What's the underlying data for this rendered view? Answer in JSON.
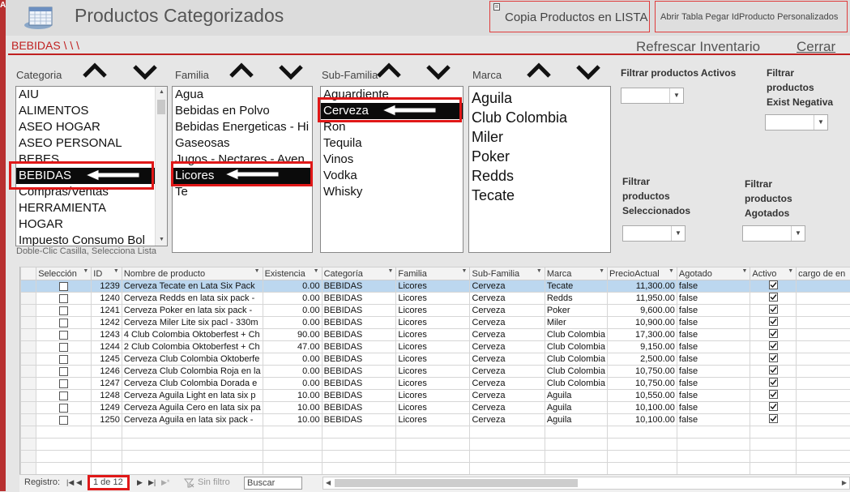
{
  "window": {
    "title": "Productos Categorizados",
    "left_strip_char": "A"
  },
  "toolbar": {
    "copy_label": "Copia Productos en LISTA",
    "open_label": "Abrir Tabla Pegar IdProducto Personalizados"
  },
  "header": {
    "breadcrumb": "BEBIDAS \\ \\ \\",
    "refresh_label": "Refrescar Inventario",
    "close_label": "Cerrar"
  },
  "categoria": {
    "label": "Categoria",
    "items": [
      "AIU",
      "ALIMENTOS",
      "ASEO HOGAR",
      "ASEO PERSONAL",
      "BEBES",
      "BEBIDAS",
      "Compras/Ventas",
      "HERRAMIENTA",
      "HOGAR",
      "Impuesto Consumo Bol"
    ],
    "selected": "BEBIDAS"
  },
  "familia": {
    "label": "Familia",
    "items": [
      "Agua",
      "Bebidas en Polvo",
      "Bebidas Energeticas - Hi",
      "Gaseosas",
      "Jugos - Nectares - Aven",
      "Licores",
      "Te"
    ],
    "selected": "Licores"
  },
  "subfamilia": {
    "label": "Sub-Familia",
    "items": [
      "Aguardiente",
      "Cerveza",
      "Ron",
      "Tequila",
      "Vinos",
      "Vodka",
      "Whisky"
    ],
    "selected": "Cerveza"
  },
  "marca": {
    "label": "Marca",
    "items": [
      "Aguila",
      "Club Colombia",
      "Miler",
      "Poker",
      "Redds",
      "Tecate"
    ]
  },
  "hint": "Doble-Clic Casilla, Selecciona Lista",
  "filters": {
    "activos": [
      "Filtrar productos Activos"
    ],
    "exist_negativa": [
      "Filtrar",
      "productos",
      "Exist Negativa"
    ],
    "seleccionados": [
      "Filtrar",
      "productos",
      "Seleccionados"
    ],
    "agotados": [
      "Filtrar",
      "productos",
      "Agotados"
    ]
  },
  "grid": {
    "columns": [
      "Selección",
      "ID",
      "Nombre de producto",
      "Existencia",
      "Categoría",
      "Familia",
      "Sub-Familia",
      "Marca",
      "PrecioActual",
      "Agotado",
      "Activo",
      "cargo de en"
    ],
    "rows": [
      {
        "id": "1239",
        "nombre": "Cerveza Tecate en Lata Six Pack",
        "existencia": "0.00",
        "categoria": "BEBIDAS",
        "familia": "Licores",
        "subfamilia": "Cerveza",
        "marca": "Tecate",
        "precio": "11,300.00",
        "agotado": "false",
        "selected": true
      },
      {
        "id": "1240",
        "nombre": "Cerveza Redds en lata six pack -",
        "existencia": "0.00",
        "categoria": "BEBIDAS",
        "familia": "Licores",
        "subfamilia": "Cerveza",
        "marca": "Redds",
        "precio": "11,950.00",
        "agotado": "false"
      },
      {
        "id": "1241",
        "nombre": "Cerveza Poker en lata six pack -",
        "existencia": "0.00",
        "categoria": "BEBIDAS",
        "familia": "Licores",
        "subfamilia": "Cerveza",
        "marca": "Poker",
        "precio": "9,600.00",
        "agotado": "false"
      },
      {
        "id": "1242",
        "nombre": "Cerveza Miler Lite six pacl - 330m",
        "existencia": "0.00",
        "categoria": "BEBIDAS",
        "familia": "Licores",
        "subfamilia": "Cerveza",
        "marca": "Miler",
        "precio": "10,900.00",
        "agotado": "false"
      },
      {
        "id": "1243",
        "nombre": "4 Club Colombia Oktoberfest + Ch",
        "existencia": "90.00",
        "categoria": "BEBIDAS",
        "familia": "Licores",
        "subfamilia": "Cerveza",
        "marca": "Club Colombia",
        "precio": "17,300.00",
        "agotado": "false"
      },
      {
        "id": "1244",
        "nombre": "2 Club Colombia Oktoberfest + Ch",
        "existencia": "47.00",
        "categoria": "BEBIDAS",
        "familia": "Licores",
        "subfamilia": "Cerveza",
        "marca": "Club Colombia",
        "precio": "9,150.00",
        "agotado": "false"
      },
      {
        "id": "1245",
        "nombre": "Cerveza Club Colombia Oktoberfe",
        "existencia": "0.00",
        "categoria": "BEBIDAS",
        "familia": "Licores",
        "subfamilia": "Cerveza",
        "marca": "Club Colombia",
        "precio": "2,500.00",
        "agotado": "false"
      },
      {
        "id": "1246",
        "nombre": "Cerveza Club Colombia Roja en la",
        "existencia": "0.00",
        "categoria": "BEBIDAS",
        "familia": "Licores",
        "subfamilia": "Cerveza",
        "marca": "Club Colombia",
        "precio": "10,750.00",
        "agotado": "false"
      },
      {
        "id": "1247",
        "nombre": "Cerveza Club Colombia Dorada e",
        "existencia": "0.00",
        "categoria": "BEBIDAS",
        "familia": "Licores",
        "subfamilia": "Cerveza",
        "marca": "Club Colombia",
        "precio": "10,750.00",
        "agotado": "false"
      },
      {
        "id": "1248",
        "nombre": "Cerveza Aguila Light en lata six p",
        "existencia": "10.00",
        "categoria": "BEBIDAS",
        "familia": "Licores",
        "subfamilia": "Cerveza",
        "marca": "Aguila",
        "precio": "10,550.00",
        "agotado": "false"
      },
      {
        "id": "1249",
        "nombre": "Cerveza Aguila Cero en lata six pa",
        "existencia": "10.00",
        "categoria": "BEBIDAS",
        "familia": "Licores",
        "subfamilia": "Cerveza",
        "marca": "Aguila",
        "precio": "10,100.00",
        "agotado": "false"
      },
      {
        "id": "1250",
        "nombre": "Cerveza Aguila en lata six pack -",
        "existencia": "10.00",
        "categoria": "BEBIDAS",
        "familia": "Licores",
        "subfamilia": "Cerveza",
        "marca": "Aguila",
        "precio": "10,100.00",
        "agotado": "false"
      }
    ]
  },
  "navbar": {
    "record_label": "Registro:",
    "position": "1 de 12",
    "filter_label": "Sin filtro",
    "search_label": "Buscar"
  },
  "colors": {
    "accent_red": "#e01818",
    "selected_row": "#bcd7ef"
  }
}
